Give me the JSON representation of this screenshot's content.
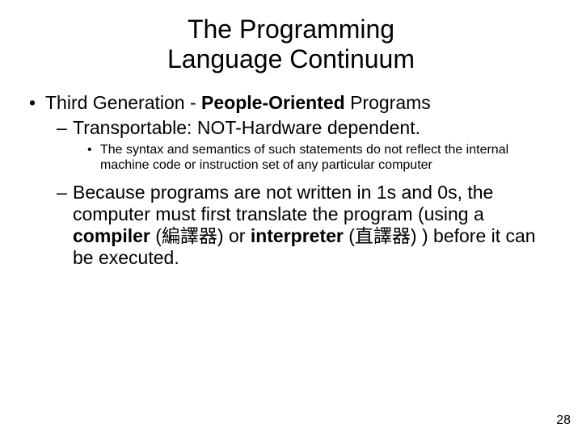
{
  "title_line1": "The Programming",
  "title_line2": "Language Continuum",
  "b1_pre": "Third Generation - ",
  "b1_bold": "People-Oriented",
  "b1_post": " Programs",
  "b2": "Transportable: NOT-Hardware dependent.",
  "b3": "The syntax and semantics of such statements do not reflect the internal machine code or instruction set of any particular computer",
  "b4_a": "Because programs are not written in 1s and 0s, the computer must first translate the program (using a ",
  "b4_bold1": "compiler",
  "b4_b": " (編譯器) or ",
  "b4_bold2": "interpreter",
  "b4_c": " (直譯器) ) before it can be executed.",
  "page_number": "28"
}
